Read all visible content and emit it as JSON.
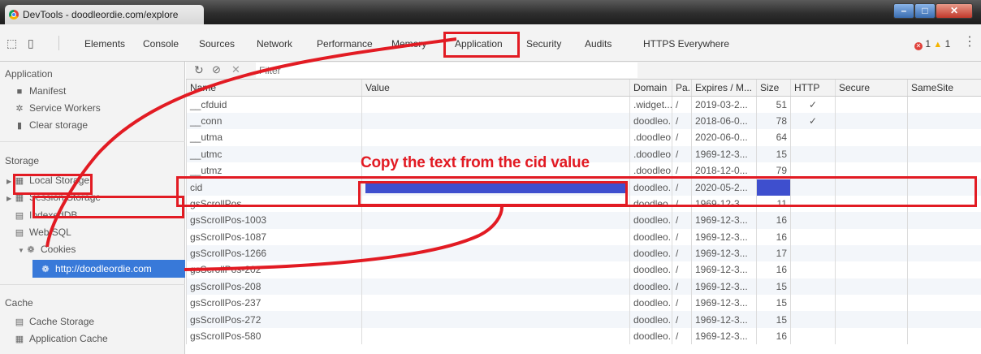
{
  "window": {
    "title": "DevTools - doodleordie.com/explore"
  },
  "toolbar": {
    "tabs": [
      "Elements",
      "Console",
      "Sources",
      "Network",
      "Performance",
      "Memory",
      "Application",
      "Security",
      "Audits",
      "HTTPS Everywhere"
    ],
    "active_tab": "Application",
    "error_count": "1",
    "warning_count": "1"
  },
  "sidebar": {
    "application_heading": "Application",
    "application_items": [
      "Manifest",
      "Service Workers",
      "Clear storage"
    ],
    "storage_heading": "Storage",
    "storage_items": [
      "Local Storage",
      "Session Storage",
      "IndexedDB",
      "Web SQL",
      "Cookies"
    ],
    "cookie_domain": "http://doodleordie.com",
    "cache_heading": "Cache",
    "cache_items": [
      "Cache Storage",
      "Application Cache"
    ]
  },
  "filter": {
    "placeholder": "Filter"
  },
  "table": {
    "columns": [
      "Name",
      "Value",
      "Domain",
      "Pa...",
      "Expires / M...",
      "Size",
      "HTTP",
      "Secure",
      "SameSite"
    ],
    "rows": [
      {
        "name": "__cfduid",
        "value": "",
        "domain": ".widget...",
        "path": "/",
        "expires": "2019-03-2...",
        "size": "51",
        "http": "✓"
      },
      {
        "name": "__conn",
        "value": "",
        "domain": "doodleo...",
        "path": "/",
        "expires": "2018-06-0...",
        "size": "78",
        "http": "✓"
      },
      {
        "name": "__utma",
        "value": "",
        "domain": ".doodleo...",
        "path": "/",
        "expires": "2020-06-0...",
        "size": "64",
        "http": ""
      },
      {
        "name": "__utmc",
        "value": "",
        "domain": ".doodleo...",
        "path": "/",
        "expires": "1969-12-3...",
        "size": "15",
        "http": ""
      },
      {
        "name": "__utmz",
        "value": "",
        "domain": ".doodleo...",
        "path": "/",
        "expires": "2018-12-0...",
        "size": "79",
        "http": ""
      },
      {
        "name": "cid",
        "value": "",
        "domain": "doodleo...",
        "path": "/",
        "expires": "2020-05-2...",
        "size": "",
        "http": ""
      },
      {
        "name": "gsScrollPos",
        "value": "",
        "domain": "doodleo...",
        "path": "/",
        "expires": "1969-12-3...",
        "size": "11",
        "http": ""
      },
      {
        "name": "gsScrollPos-1003",
        "value": "",
        "domain": "doodleo...",
        "path": "/",
        "expires": "1969-12-3...",
        "size": "16",
        "http": ""
      },
      {
        "name": "gsScrollPos-1087",
        "value": "",
        "domain": "doodleo...",
        "path": "/",
        "expires": "1969-12-3...",
        "size": "16",
        "http": ""
      },
      {
        "name": "gsScrollPos-1266",
        "value": "",
        "domain": "doodleo...",
        "path": "/",
        "expires": "1969-12-3...",
        "size": "17",
        "http": ""
      },
      {
        "name": "gsScrollPos-202",
        "value": "",
        "domain": "doodleo...",
        "path": "/",
        "expires": "1969-12-3...",
        "size": "16",
        "http": ""
      },
      {
        "name": "gsScrollPos-208",
        "value": "",
        "domain": "doodleo...",
        "path": "/",
        "expires": "1969-12-3...",
        "size": "15",
        "http": ""
      },
      {
        "name": "gsScrollPos-237",
        "value": "",
        "domain": "doodleo...",
        "path": "/",
        "expires": "1969-12-3...",
        "size": "15",
        "http": ""
      },
      {
        "name": "gsScrollPos-272",
        "value": "",
        "domain": "doodleo...",
        "path": "/",
        "expires": "1969-12-3...",
        "size": "15",
        "http": ""
      },
      {
        "name": "gsScrollPos-580",
        "value": "",
        "domain": "doodleo...",
        "path": "/",
        "expires": "1969-12-3...",
        "size": "16",
        "http": ""
      }
    ],
    "redacted_row": "cid"
  },
  "annotation": {
    "text": "Copy the text from the cid value"
  },
  "colors": {
    "highlight_red": "#e21b23",
    "selection_blue": "#3879d9",
    "redaction_blue": "#3e4fce"
  }
}
